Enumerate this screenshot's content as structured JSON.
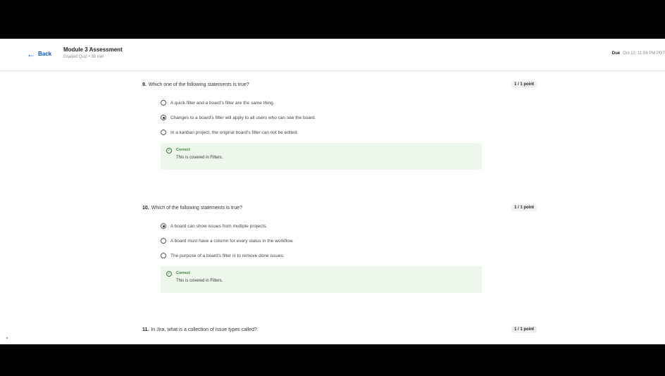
{
  "header": {
    "back_label": "Back",
    "title": "Module 3 Assessment",
    "subtitle": "Graded Quiz • 30 min",
    "due_label": "Due",
    "due_value": "Oct 10, 11:59 PM PDT"
  },
  "questions": [
    {
      "number": "9.",
      "text": "Which one of the following statements is true?",
      "points": "1 / 1 point",
      "options": [
        {
          "label": "A quick filter and a board's filter are the same thing.",
          "selected": false
        },
        {
          "label": "Changes to a board's filter will apply to all users who can see the board.",
          "selected": true
        },
        {
          "label": "In a kanban project, the original board's filter can not be edited.",
          "selected": false
        }
      ],
      "feedback": {
        "status": "Correct",
        "text": "This is covered in Filters."
      }
    },
    {
      "number": "10.",
      "text": "Which of the following statements is true?",
      "points": "1 / 1 point",
      "options": [
        {
          "label": "A board can show issues from multiple projects.",
          "selected": true
        },
        {
          "label": "A board must have a column for every status in the workflow.",
          "selected": false
        },
        {
          "label": "The purpose of a board's filter is to remove done issues.",
          "selected": false
        }
      ],
      "feedback": {
        "status": "Correct",
        "text": "This is covered in Filters."
      }
    },
    {
      "number": "11.",
      "text": "In Jira, what is a collection of issue types called?",
      "points": "1 / 1 point"
    }
  ]
}
